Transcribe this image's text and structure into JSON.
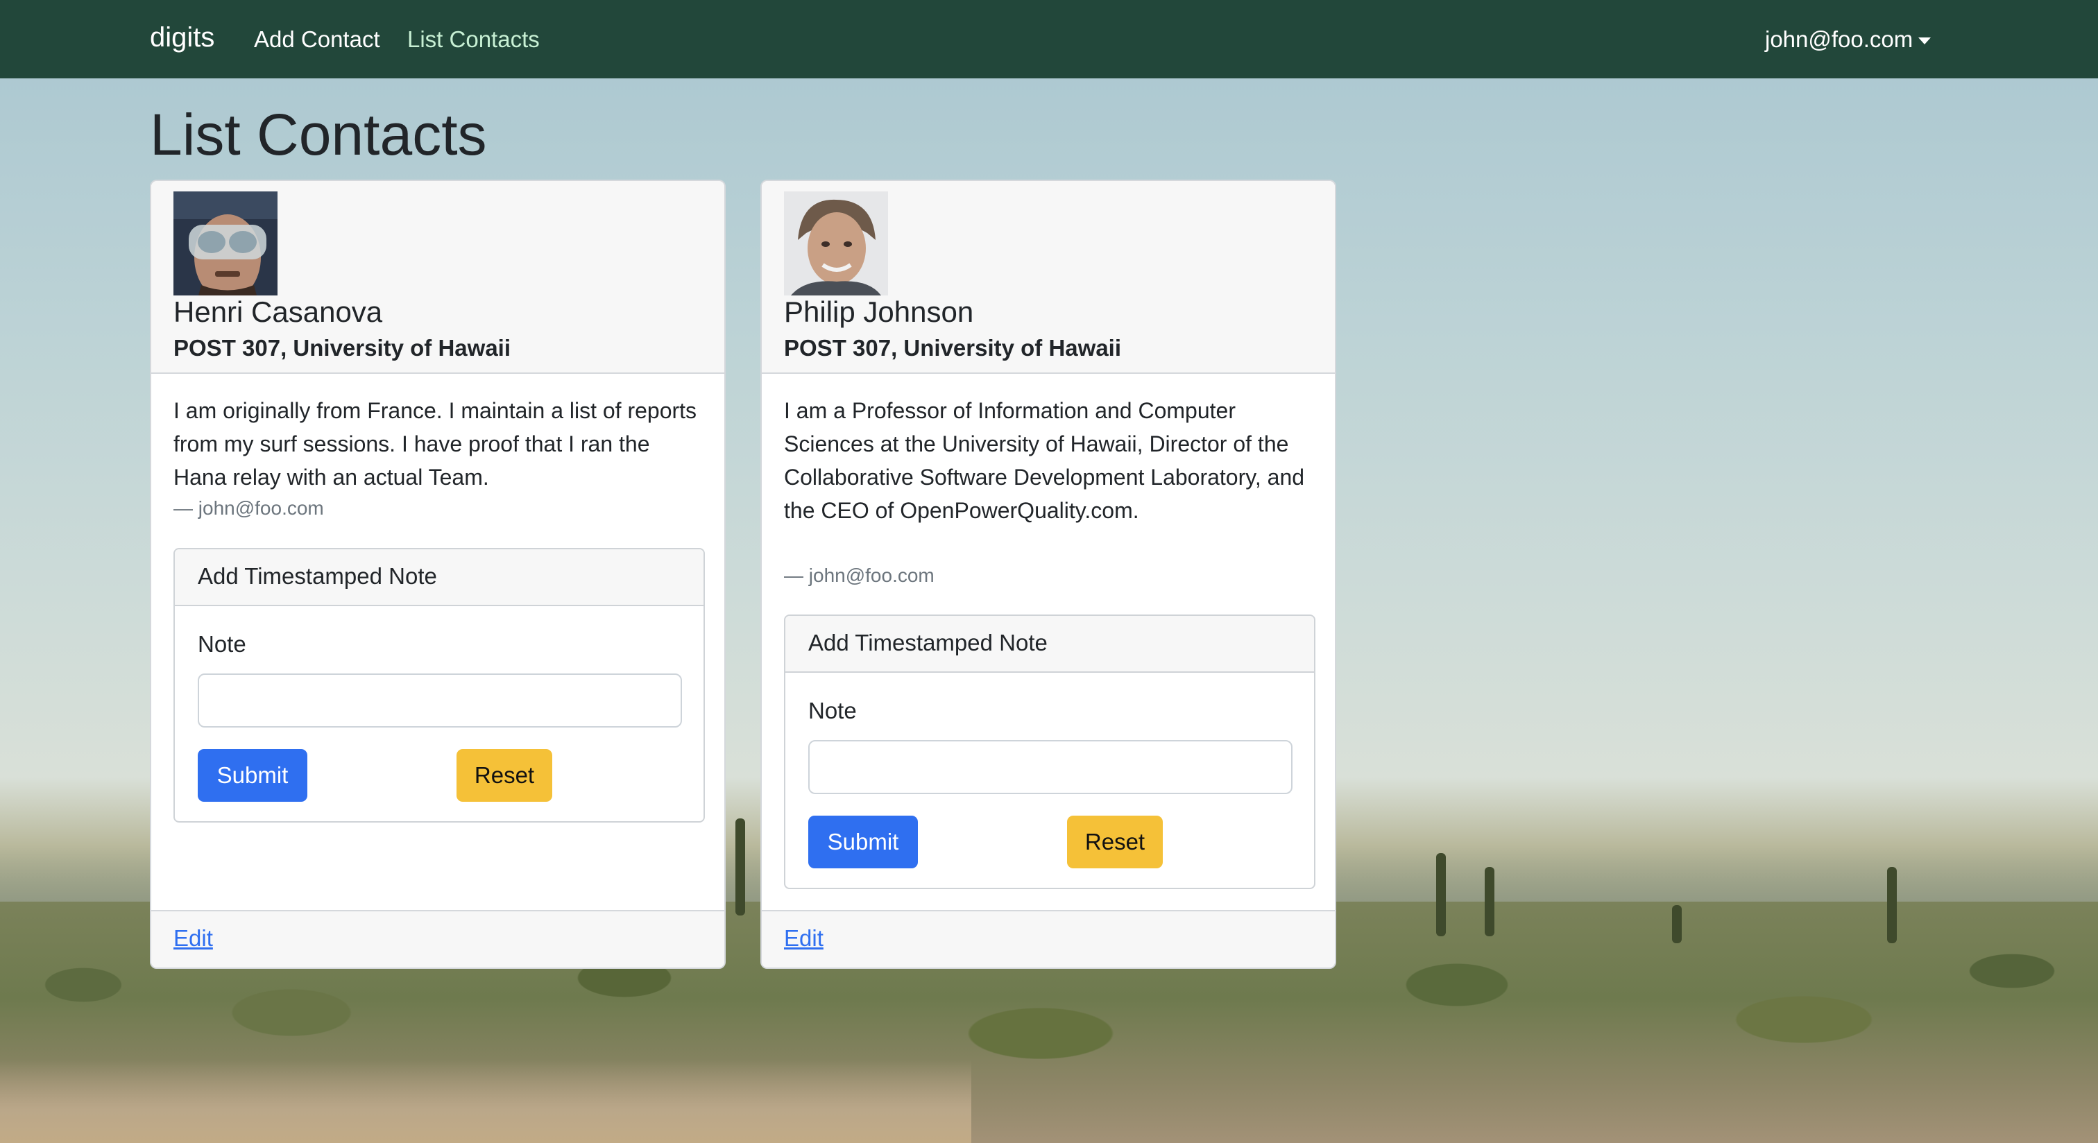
{
  "navbar": {
    "brand": "digits",
    "links": [
      {
        "label": "Add Contact"
      },
      {
        "label": "List Contacts",
        "active": true
      }
    ],
    "user": "john@foo.com"
  },
  "page": {
    "title": "List Contacts"
  },
  "contacts": [
    {
      "name": "Henri Casanova",
      "address": "POST 307, University of Hawaii",
      "description": "I am originally from France. I maintain a list of reports from my surf sessions. I have proof that I ran the Hana relay with an actual Team.",
      "owner": "— john@foo.com",
      "note_form": {
        "title": "Add Timestamped Note",
        "label": "Note",
        "value": "",
        "submit": "Submit",
        "reset": "Reset"
      },
      "edit": "Edit"
    },
    {
      "name": "Philip Johnson",
      "address": "POST 307, University of Hawaii",
      "description": "I am a Professor of Information and Computer Sciences at the University of Hawaii, Director of the Collaborative Software Development Laboratory, and the CEO of OpenPowerQuality.com.",
      "owner": "— john@foo.com",
      "note_form": {
        "title": "Add Timestamped Note",
        "label": "Note",
        "value": "",
        "submit": "Submit",
        "reset": "Reset"
      },
      "edit": "Edit"
    }
  ],
  "colors": {
    "navbar": "#22473a",
    "primary": "#2f6ff0",
    "warning": "#f5c138"
  }
}
